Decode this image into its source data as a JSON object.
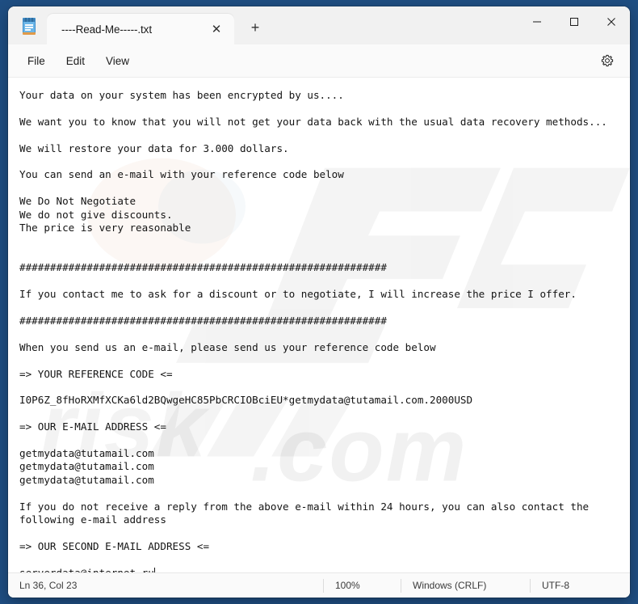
{
  "window": {
    "app_icon": "notepad-icon",
    "tab_title": "----Read-Me-----.txt",
    "tab_close_glyph": "✕",
    "new_tab_glyph": "+",
    "minimize_label": "Minimize",
    "maximize_label": "Maximize",
    "close_label": "Close"
  },
  "menubar": {
    "items": [
      {
        "label": "File",
        "name": "menu-file"
      },
      {
        "label": "Edit",
        "name": "menu-edit"
      },
      {
        "label": "View",
        "name": "menu-view"
      }
    ],
    "settings_label": "Settings"
  },
  "editor": {
    "watermark_text": "pcrisk.com",
    "content": "Your data on your system has been encrypted by us....\n\nWe want you to know that you will not get your data back with the usual data recovery methods...\n\nWe will restore your data for 3.000 dollars.\n\nYou can send an e-mail with your reference code below\n\nWe Do Not Negotiate\nWe do not give discounts.\nThe price is very reasonable\n\n\n############################################################\n\nIf you contact me to ask for a discount or to negotiate, I will increase the price I offer.\n\n############################################################\n\nWhen you send us an e-mail, please send us your reference code below\n\n=> YOUR REFERENCE CODE <=\n\nI0P6Z_8fHoRXMfXCKa6ld2BQwgeHC85PbCRCIOBciEU*getmydata@tutamail.com.2000USD\n\n=> OUR E-MAIL ADDRESS <=\n\ngetmydata@tutamail.com\ngetmydata@tutamail.com\ngetmydata@tutamail.com\n\nIf you do not receive a reply from the above e-mail within 24 hours, you can also contact the\nfollowing e-mail address\n\n=> OUR SECOND E-MAIL ADDRESS <=\n\nserverdata@internet.ru"
  },
  "statusbar": {
    "line_col": "Ln 36, Col 23",
    "zoom": "100%",
    "line_ending": "Windows (CRLF)",
    "encoding": "UTF-8"
  },
  "colors": {
    "desktop": "#1f4e82",
    "window_chrome": "#f1f1f1",
    "editor_background": "#ffffff",
    "text": "#141414"
  }
}
